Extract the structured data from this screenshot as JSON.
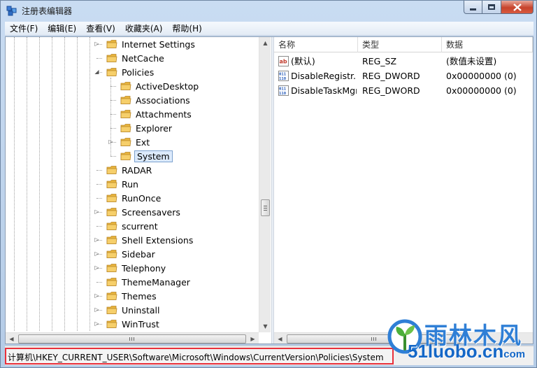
{
  "window": {
    "title": "注册表编辑器",
    "controls": {
      "minimize_icon": "minimize-icon",
      "maximize_icon": "maximize-icon",
      "close_icon": "close-icon"
    }
  },
  "menu": {
    "items": [
      {
        "label": "文件(F)"
      },
      {
        "label": "编辑(E)"
      },
      {
        "label": "查看(V)"
      },
      {
        "label": "收藏夹(A)"
      },
      {
        "label": "帮助(H)"
      }
    ]
  },
  "tree": {
    "items": [
      {
        "label": "Internet Settings",
        "level": 1,
        "expander": "collapsed"
      },
      {
        "label": "NetCache",
        "level": 1,
        "expander": "none"
      },
      {
        "label": "Policies",
        "level": 1,
        "expander": "expanded"
      },
      {
        "label": "ActiveDesktop",
        "level": 2,
        "expander": "none"
      },
      {
        "label": "Associations",
        "level": 2,
        "expander": "none"
      },
      {
        "label": "Attachments",
        "level": 2,
        "expander": "none"
      },
      {
        "label": "Explorer",
        "level": 2,
        "expander": "none"
      },
      {
        "label": "Ext",
        "level": 2,
        "expander": "collapsed"
      },
      {
        "label": "System",
        "level": 2,
        "expander": "none",
        "selected": true
      },
      {
        "label": "RADAR",
        "level": 1,
        "expander": "none"
      },
      {
        "label": "Run",
        "level": 1,
        "expander": "none"
      },
      {
        "label": "RunOnce",
        "level": 1,
        "expander": "none"
      },
      {
        "label": "Screensavers",
        "level": 1,
        "expander": "collapsed"
      },
      {
        "label": "scurrent",
        "level": 1,
        "expander": "none"
      },
      {
        "label": "Shell Extensions",
        "level": 1,
        "expander": "collapsed"
      },
      {
        "label": "Sidebar",
        "level": 1,
        "expander": "collapsed"
      },
      {
        "label": "Telephony",
        "level": 1,
        "expander": "collapsed"
      },
      {
        "label": "ThemeManager",
        "level": 1,
        "expander": "none"
      },
      {
        "label": "Themes",
        "level": 1,
        "expander": "collapsed"
      },
      {
        "label": "Uninstall",
        "level": 1,
        "expander": "collapsed"
      },
      {
        "label": "WinTrust",
        "level": 1,
        "expander": "collapsed"
      }
    ]
  },
  "list": {
    "columns": [
      {
        "label": "名称"
      },
      {
        "label": "类型"
      },
      {
        "label": "数据"
      }
    ],
    "rows": [
      {
        "name": "(默认)",
        "type": "REG_SZ",
        "data": "(数值未设置)",
        "icon": "string-value-icon"
      },
      {
        "name": "DisableRegistr...",
        "type": "REG_DWORD",
        "data": "0x00000000 (0)",
        "icon": "binary-value-icon"
      },
      {
        "name": "DisableTaskMgr",
        "type": "REG_DWORD",
        "data": "0x00000000 (0)",
        "icon": "binary-value-icon"
      }
    ]
  },
  "status": {
    "path": "计算机\\HKEY_CURRENT_USER\\Software\\Microsoft\\Windows\\CurrentVersion\\Policies\\System"
  },
  "watermark": {
    "name_cn": "雨林木风",
    "domain_main": "51luobo.cn",
    "domain_suffix": "com"
  },
  "colors": {
    "folder": "#e8b43c",
    "selection": "#dceafc",
    "highlight_border": "#e8313c",
    "watermark": "#2f7fd6"
  }
}
